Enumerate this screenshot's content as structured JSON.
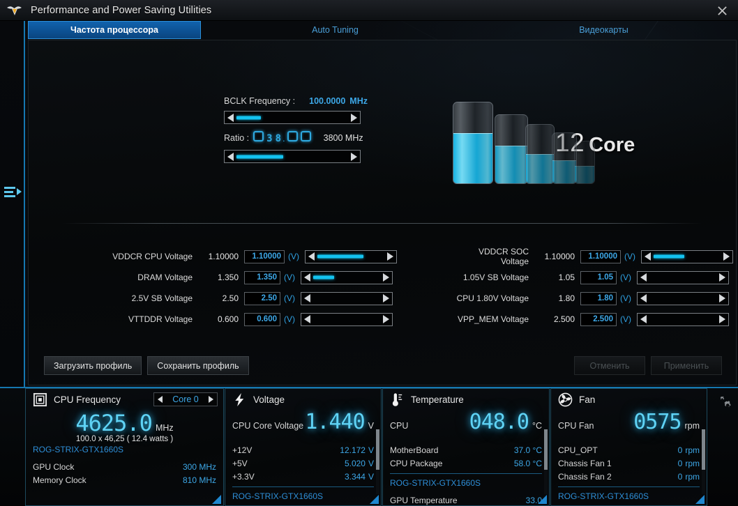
{
  "window": {
    "title": "Performance and Power Saving Utilities",
    "logo_icon": "tuf-gaming-logo-icon",
    "close_icon": "close-icon"
  },
  "rail": {
    "toggle_icon": "hamburger-expand-icon"
  },
  "tabs": [
    {
      "label": "Частота процессора",
      "active": true
    },
    {
      "label": "Auto Tuning",
      "active": false
    },
    {
      "label": "Видеокарты",
      "active": false
    }
  ],
  "bclk": {
    "label": "BCLK Frequency :",
    "value": "100.0000",
    "unit": "MHz",
    "slider_percent": 22,
    "ratio_label": "Ratio :",
    "ratio_digits": [
      "0",
      "3",
      "8",
      ".",
      "0",
      "0"
    ],
    "ratio_result": "3800 MHz",
    "ratio_slider_percent": 42
  },
  "cores": {
    "count": "12",
    "unit": "Core",
    "tube_fill_percent": [
      62,
      55,
      50,
      46,
      42
    ]
  },
  "voltages": {
    "unit": "(V)",
    "left": [
      {
        "name": "VDDCR CPU Voltage",
        "current": "1.10000",
        "value": "1.10000",
        "slider_percent": 66
      },
      {
        "name": "DRAM Voltage",
        "current": "1.350",
        "value": "1.350",
        "slider_percent": 30
      },
      {
        "name": "2.5V SB Voltage",
        "current": "2.50",
        "value": "2.50",
        "slider_percent": 0
      },
      {
        "name": "VTTDDR Voltage",
        "current": "0.600",
        "value": "0.600",
        "slider_percent": 0
      }
    ],
    "right": [
      {
        "name": "VDDCR SOC Voltage",
        "current": "1.10000",
        "value": "1.10000",
        "slider_percent": 44
      },
      {
        "name": "1.05V SB Voltage",
        "current": "1.05",
        "value": "1.05",
        "slider_percent": 0
      },
      {
        "name": "CPU 1.80V Voltage",
        "current": "1.80",
        "value": "1.80",
        "slider_percent": 0
      },
      {
        "name": "VPP_MEM Voltage",
        "current": "2.500",
        "value": "2.500",
        "slider_percent": 0
      }
    ]
  },
  "actions": {
    "load_profile": "Загрузить профиль",
    "save_profile": "Сохранить профиль",
    "cancel": "Отменить",
    "apply": "Применить"
  },
  "monitor": {
    "cpu_frequency": {
      "icon": "cpu-chip-icon",
      "title": "CPU Frequency",
      "core_prev_icon": "chevron-left-icon",
      "core_next_icon": "chevron-right-icon",
      "core_selected": "Core 0",
      "value": "4625.0",
      "unit": "MHz",
      "subline": "100.0  x 46,25 ( 12.4   watts )",
      "gpu_name": "ROG-STRIX-GTX1660S",
      "rows": [
        {
          "key": "GPU Clock",
          "value": "300 MHz"
        },
        {
          "key": "Memory Clock",
          "value": "810 MHz"
        }
      ]
    },
    "voltage": {
      "icon": "lightning-bolt-icon",
      "title": "Voltage",
      "big_label": "CPU Core Voltage",
      "value": "1.440",
      "unit": "V",
      "rows": [
        {
          "key": "+12V",
          "value": "12.172",
          "unit": "V"
        },
        {
          "key": "+5V",
          "value": "5.020",
          "unit": "V"
        },
        {
          "key": "+3.3V",
          "value": "3.344",
          "unit": "V"
        }
      ],
      "gpu_name": "ROG-STRIX-GTX1660S"
    },
    "temperature": {
      "icon": "thermometer-icon",
      "title": "Temperature",
      "big_label": "CPU",
      "value": "048.0",
      "unit": "°C",
      "rows": [
        {
          "key": "MotherBoard",
          "value": "37.0 °C"
        },
        {
          "key": "CPU Package",
          "value": "58.0 °C"
        }
      ],
      "gpu_name": "ROG-STRIX-GTX1660S",
      "gpu_row": {
        "key": "GPU Temperature",
        "value": "33.0"
      }
    },
    "fan": {
      "icon": "fan-icon",
      "title": "Fan",
      "big_label": "CPU Fan",
      "value": "0575",
      "unit": "rpm",
      "rows": [
        {
          "key": "CPU_OPT",
          "value": "0",
          "unit": "rpm"
        },
        {
          "key": "Chassis Fan 1",
          "value": "0",
          "unit": "rpm"
        },
        {
          "key": "Chassis Fan 2",
          "value": "0",
          "unit": "rpm"
        }
      ],
      "gpu_name": "ROG-STRIX-GTX1660S"
    },
    "settings_icon": "gears-icon"
  },
  "colors": {
    "accent_blue": "#1577b0",
    "cyan_glow": "#5fd3f5",
    "tab_active": "#0d5396",
    "link_blue": "#3da8e8"
  }
}
